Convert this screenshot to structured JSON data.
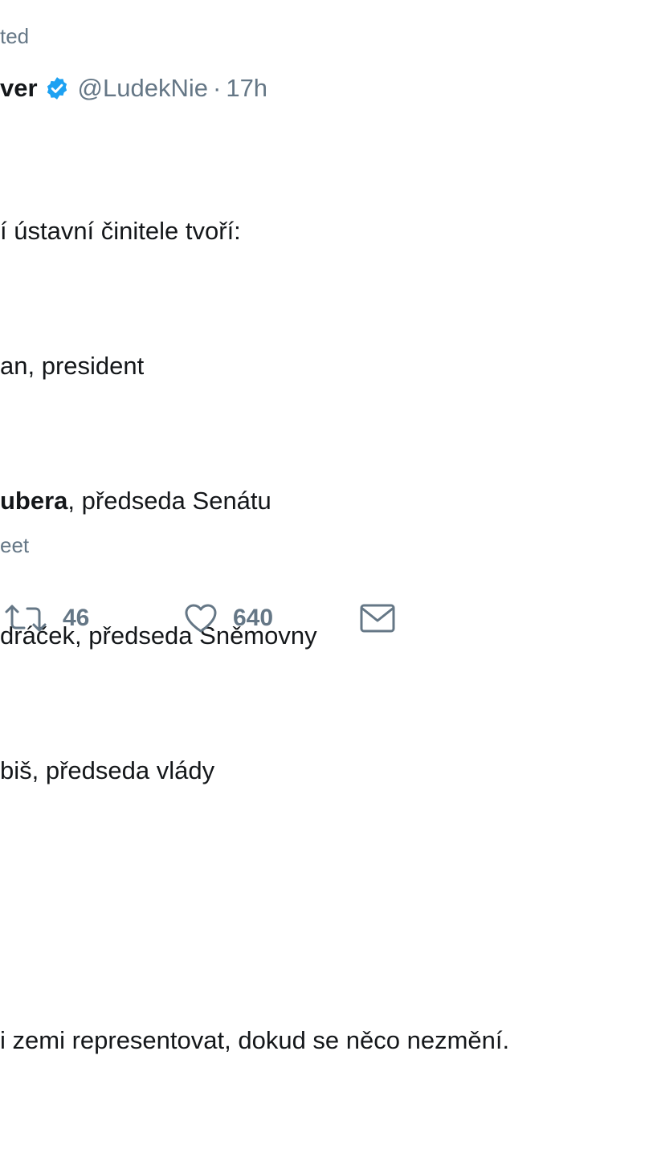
{
  "retweet_context": "ted",
  "author": {
    "name_tail": "ver",
    "handle": "@LudekNie",
    "separator": "·",
    "time": "17h"
  },
  "body": {
    "line1": "í ústavní činitele tvoří:",
    "line2": "an, president",
    "line3_bold": "ubera",
    "line3_rest": ", předseda Senátu",
    "line4": "dráček, předseda Sněmovny",
    "line5": "biš, předseda vlády",
    "line6": "i zemi representovat, dokud se něco nezmění."
  },
  "footer_context": "eet",
  "actions": {
    "retweet_count": "46",
    "like_count": "640"
  },
  "colors": {
    "accent": "#1da1f2",
    "muted": "#657786",
    "text": "#14171a"
  },
  "icons": [
    "verified-badge-icon",
    "retweet-icon",
    "like-icon",
    "message-icon"
  ]
}
